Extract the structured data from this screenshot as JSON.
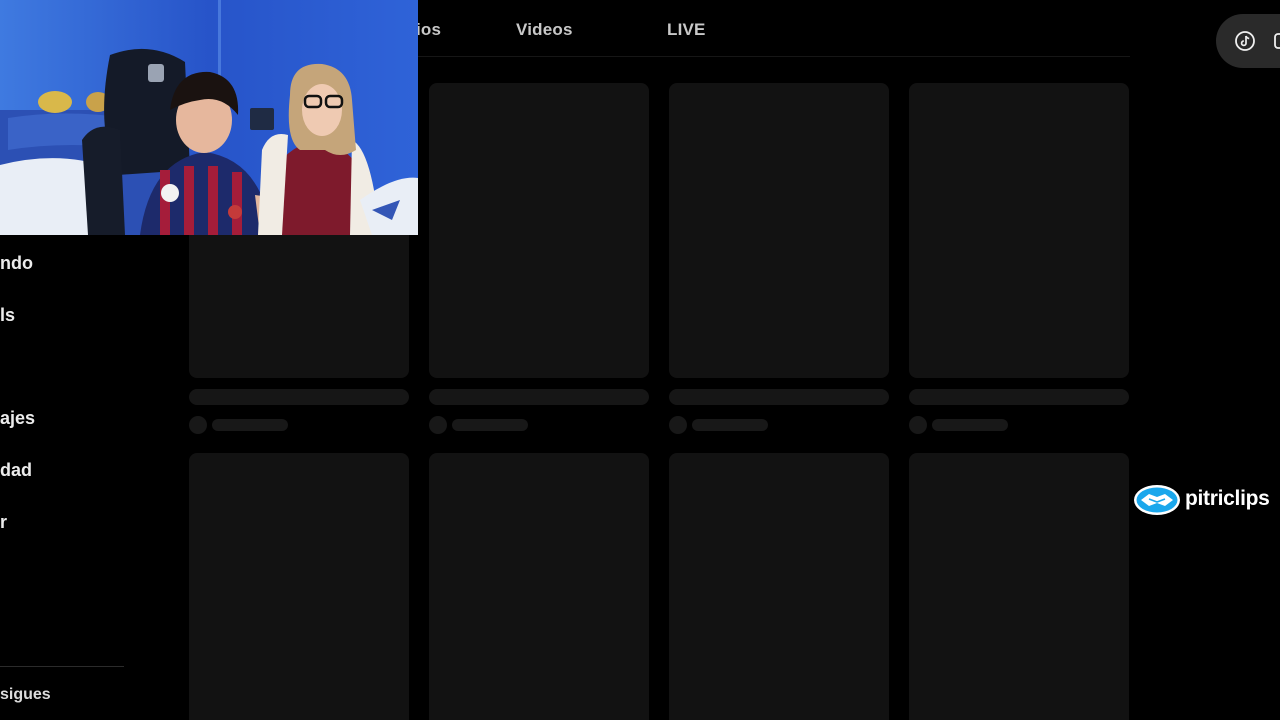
{
  "tabs": {
    "items": [
      {
        "label": "ios"
      },
      {
        "label": "Videos"
      },
      {
        "label": "LIVE"
      }
    ]
  },
  "header": {
    "icons": [
      "tiktok-icon",
      "window-icon"
    ]
  },
  "sidebar": {
    "items": [
      {
        "label": "ndo"
      },
      {
        "label": "ls"
      },
      {
        "label": "ajes"
      },
      {
        "label": "dad"
      },
      {
        "label": "r"
      }
    ],
    "section_label": "sigues"
  },
  "watermark": {
    "text": "pitriclips",
    "icon": "handshake-icon"
  },
  "colors": {
    "background": "#000000",
    "placeholder": "#121212",
    "accent_blue": "#1aa7ec"
  }
}
